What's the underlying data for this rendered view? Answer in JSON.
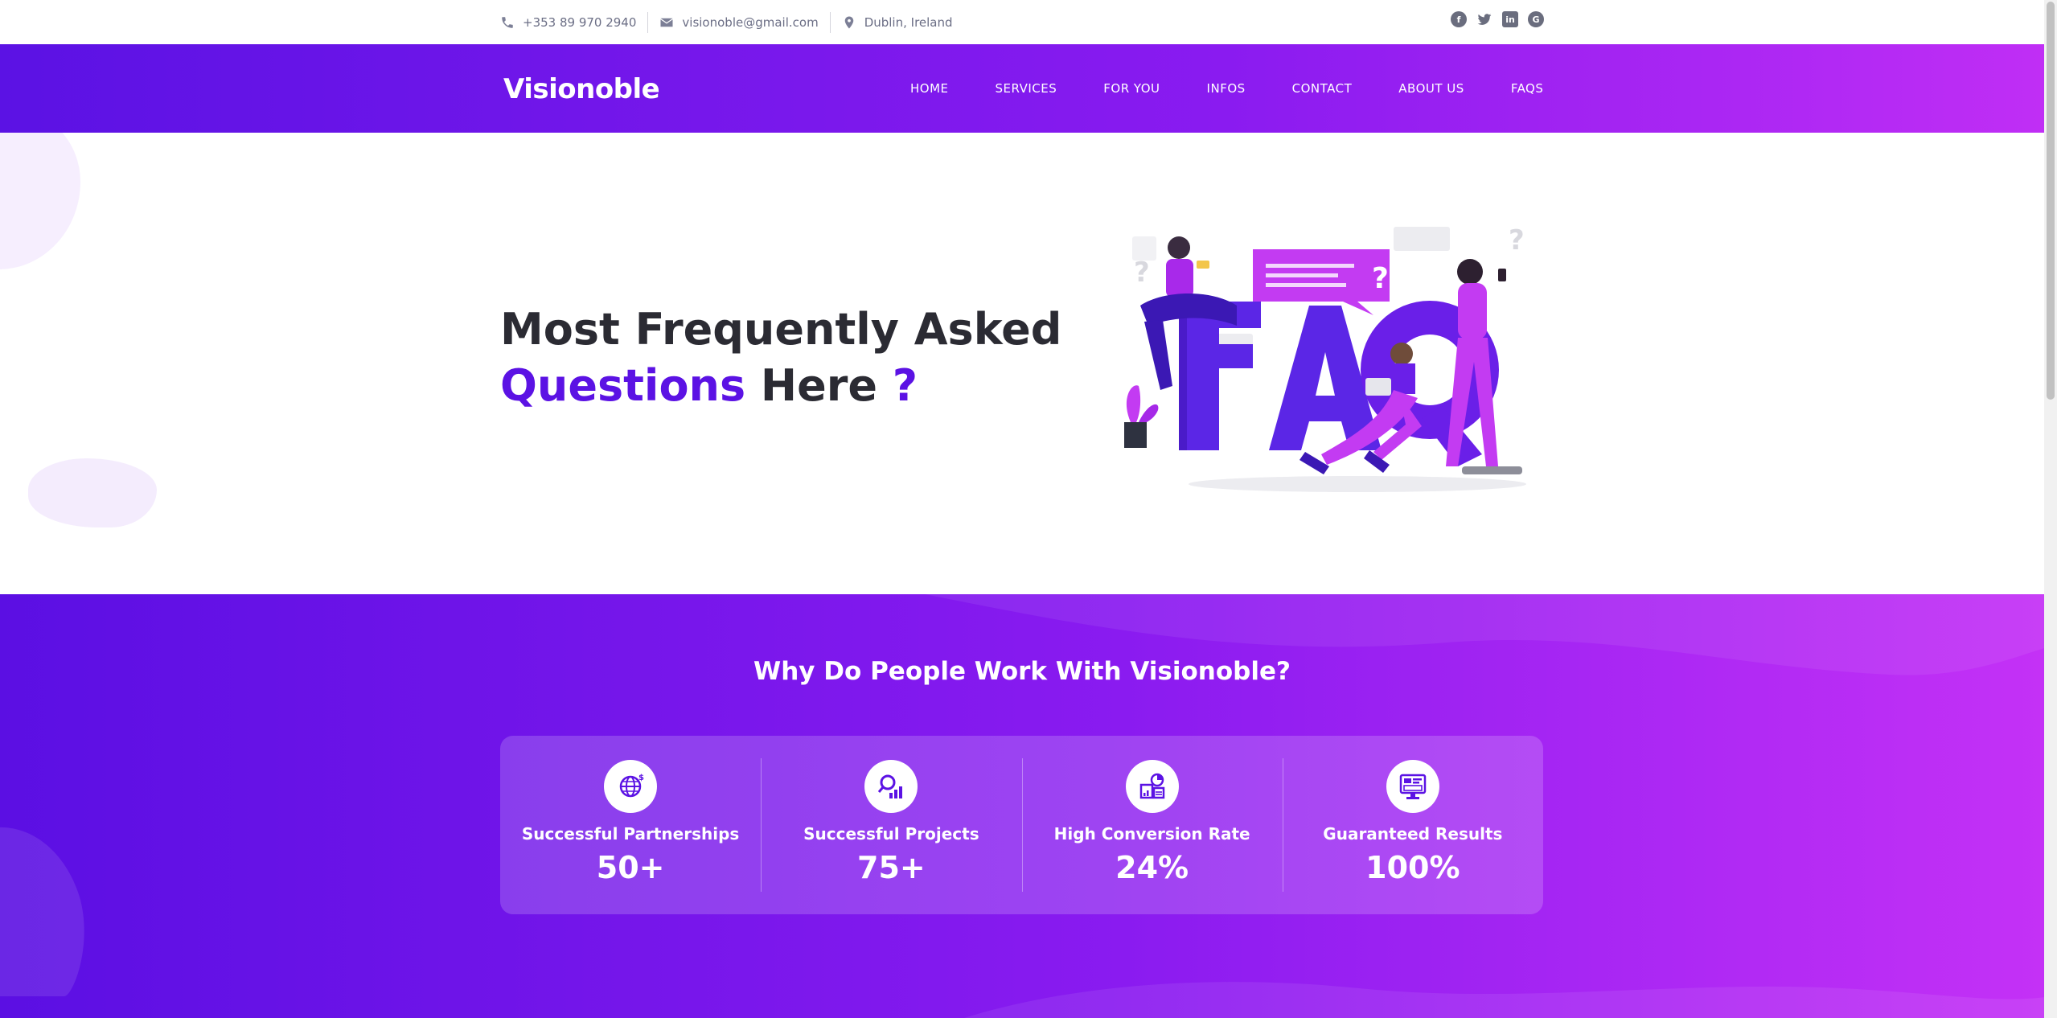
{
  "topbar": {
    "phone": "+353 89 970 2940",
    "email": "visionoble@gmail.com",
    "location": "Dublin, Ireland",
    "socials": [
      "facebook-icon",
      "twitter-icon",
      "linkedin-icon",
      "google-plus-icon"
    ]
  },
  "navbar": {
    "logo": "Visionoble",
    "items": [
      {
        "label": "HOME"
      },
      {
        "label": "SERVICES"
      },
      {
        "label": "FOR YOU"
      },
      {
        "label": "INFOS"
      },
      {
        "label": "CONTACT"
      },
      {
        "label": "ABOUT US"
      },
      {
        "label": "FAQS"
      }
    ]
  },
  "hero": {
    "title_line1": "Most Frequently Asked",
    "title_accent": "Questions",
    "title_rest": " Here ",
    "title_mark": "?"
  },
  "stats": {
    "heading": "Why Do People Work With Visionoble?",
    "items": [
      {
        "label": "Successful Partnerships",
        "value": "50+",
        "icon": "globe-dollar-icon"
      },
      {
        "label": "Successful Projects",
        "value": "75+",
        "icon": "search-chart-icon"
      },
      {
        "label": "High Conversion Rate",
        "value": "24%",
        "icon": "analytics-icon"
      },
      {
        "label": "Guaranteed Results",
        "value": "100%",
        "icon": "dashboard-icon"
      }
    ]
  },
  "colors": {
    "brand": "#5b12e4",
    "gradient_end": "#c02ef5",
    "text_dark": "#2b2b33",
    "muted": "#6b6e85"
  }
}
